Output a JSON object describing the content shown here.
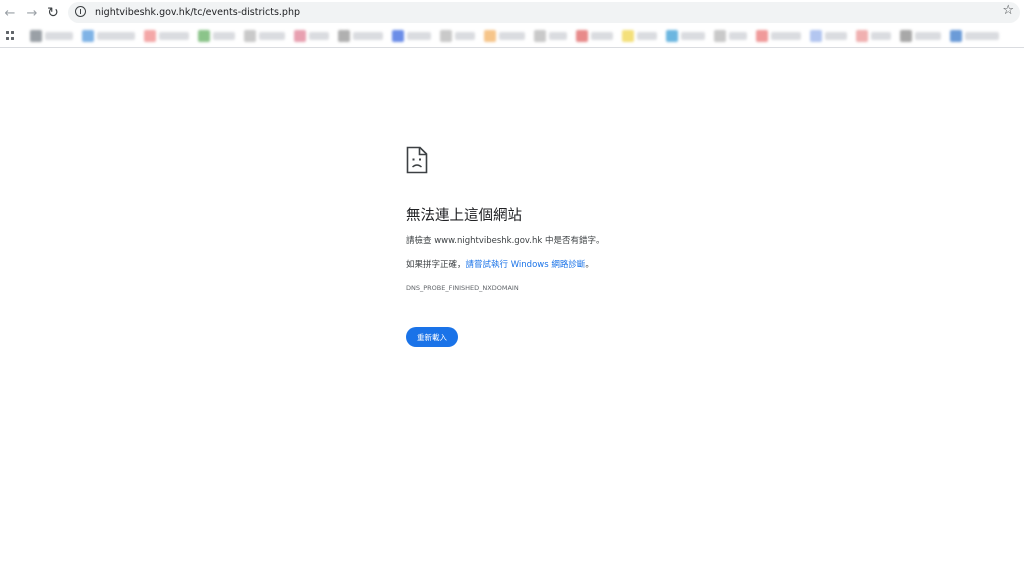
{
  "browser": {
    "url": "nightvibeshk.gov.hk/tc/events-districts.php",
    "icons": {
      "back": "arrow-left-icon",
      "forward": "arrow-right-icon",
      "reload": "reload-icon",
      "site_info": "info-icon",
      "bookmark": "star-icon",
      "apps": "apps-grid-icon"
    },
    "back_glyph": "←",
    "forward_glyph": "→",
    "reload_glyph": "↻",
    "star_glyph": "☆",
    "bookmark_favicon_colors": [
      "#9aa0a6",
      "#7fb3e6",
      "#f4a7a7",
      "#8bc48a",
      "#c9c9c9",
      "#e8a0b0",
      "#b0b0b0",
      "#6b8de8",
      "#c9c9c9",
      "#f6c58a",
      "#c9c9c9",
      "#e88a8a",
      "#f4e07a",
      "#6bb6e0",
      "#c9c9c9",
      "#f09a9a",
      "#b3c6f0",
      "#f0b0b0",
      "#a8a8a8",
      "#6b9bd8",
      "#f08aa0"
    ]
  },
  "error_page": {
    "icon": "sad-page-icon",
    "heading": "無法連上這個網站",
    "check_text": "請檢查 www.nightvibeshk.gov.hk 中是否有錯字。",
    "spelling_prefix": "如果拼字正確，",
    "diagnostics_link": "請嘗試執行 Windows 網路診斷",
    "spelling_suffix": "。",
    "error_code": "DNS_PROBE_FINISHED_NXDOMAIN",
    "reload_label": "重新載入",
    "accent_color": "#1a73e8"
  }
}
